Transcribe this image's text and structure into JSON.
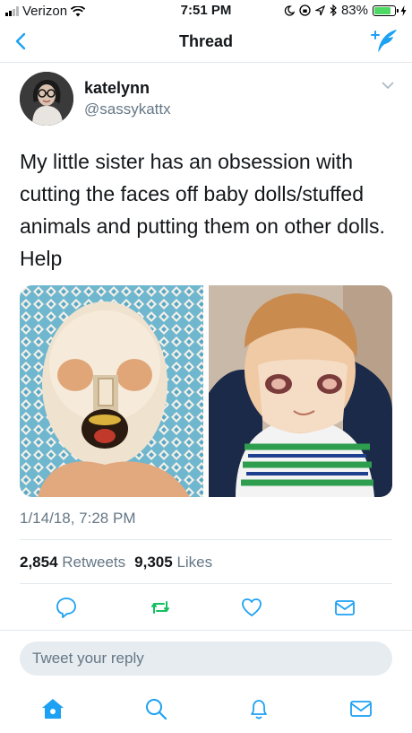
{
  "status_bar": {
    "carrier": "Verizon",
    "time": "7:51 PM",
    "battery": "83%",
    "battery_level": 0.83
  },
  "nav": {
    "title": "Thread"
  },
  "tweet": {
    "author_name": "katelynn",
    "author_handle": "@sassykattx",
    "text": "My little sister has an obsession with cutting the faces off baby dolls/stuffed animals and putting them on other dolls. Help",
    "timestamp": "1/14/18, 7:28 PM",
    "retweets_count": "2,854",
    "retweets_label": "Retweets",
    "likes_count": "9,305",
    "likes_label": "Likes"
  },
  "reply": {
    "placeholder": "Tweet your reply"
  },
  "colors": {
    "accent": "#1da1f2",
    "retweet": "#17bf63",
    "muted": "#657786"
  },
  "icons": {
    "actions": [
      "reply-icon",
      "retweet-icon",
      "like-icon",
      "direct-message-icon"
    ],
    "tabs": [
      "home-icon",
      "search-icon",
      "notifications-icon",
      "messages-icon"
    ]
  }
}
